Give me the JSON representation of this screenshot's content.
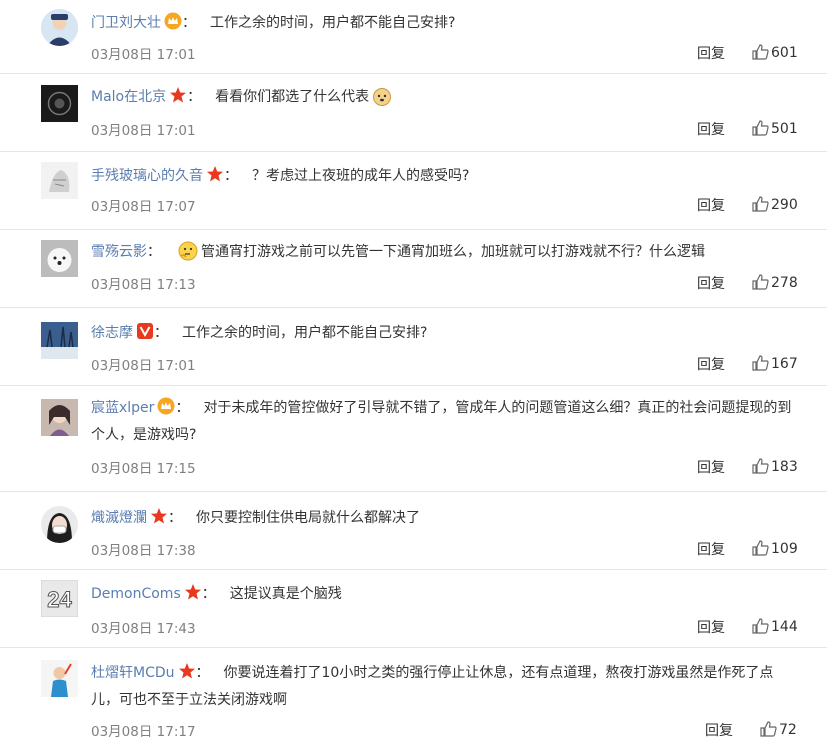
{
  "reply_label": "回复",
  "comments": [
    {
      "user": "门卫刘大壮",
      "text": "工作之余的时间，用户都不能自己安排?",
      "date": "03月08日 17:01",
      "likes": "601"
    },
    {
      "user": "Malo在北京",
      "text": "看看你们都选了什么代表",
      "date": "03月08日 17:01",
      "likes": "501"
    },
    {
      "user": "手残玻璃心的久音",
      "text": "？考虑过上夜班的成年人的感受吗?",
      "date": "03月08日 17:07",
      "likes": "290"
    },
    {
      "user": "雪殇云影",
      "text": "管通宵打游戏之前可以先管一下通宵加班么，加班就可以打游戏就不行？什么逻辑",
      "date": "03月08日 17:13",
      "likes": "278"
    },
    {
      "user": "徐志摩",
      "text": "工作之余的时间，用户都不能自己安排?",
      "date": "03月08日 17:01",
      "likes": "167"
    },
    {
      "user": "宸蓝xlper",
      "text": "对于未成年的管控做好了引导就不错了，管成年人的问题管道这么细？真正的社会问题提现的到个人，是游戏吗?",
      "date": "03月08日 17:15",
      "likes": "183"
    },
    {
      "user": "熾滅燈瀾",
      "text": "你只要控制住供电局就什么都解决了",
      "date": "03月08日 17:38",
      "likes": "109"
    },
    {
      "user": "DemonComs",
      "avatar_text": "24",
      "text": "这提议真是个脑残",
      "date": "03月08日 17:43",
      "likes": "144"
    },
    {
      "user": "杜熠轩MCDu",
      "text": "你要说连着打了10小时之类的强行停止让休息，还有点道理，熬夜打游戏虽然是作死了点儿，可也不至于立法关闭游戏啊",
      "date": "03月08日 17:17",
      "likes": "72"
    }
  ]
}
